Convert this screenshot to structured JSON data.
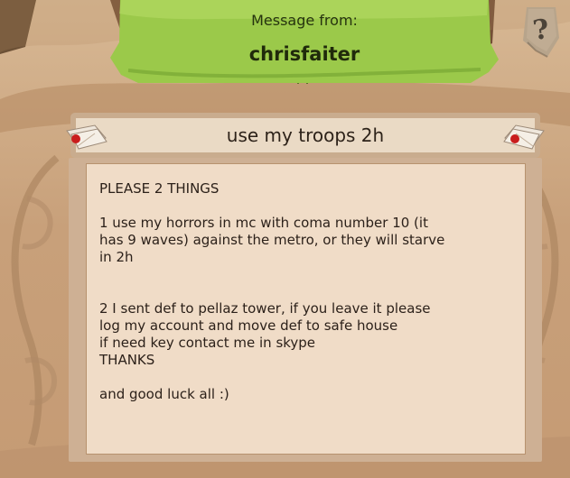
{
  "header": {
    "label": "Message from:",
    "sender": "chrisfaiter"
  },
  "help": {
    "glyph": "?"
  },
  "message": {
    "subject": "use my troops 2h",
    "body": "PLEASE 2 THINGS\n\n1 use my horrors in mc with coma number 10 (it\nhas 9 waves) against the metro, or they will starve\nin 2h\n\n\n2 I sent def to pellaz tower, if you leave it please\nlog my account and move def to safe house\nif need key contact me in skype\nTHANKS\n\nand good luck all :)"
  },
  "icons": {
    "help": "help-question-icon",
    "envelope_left": "sealed-envelope-icon",
    "envelope_right": "sealed-envelope-icon"
  },
  "colors": {
    "header_green": "#9fcb4a",
    "parchment": "#f0dcc7",
    "frame": "#ceb094",
    "seal_red": "#c91d1d",
    "help_stone": "#b7a48b"
  }
}
